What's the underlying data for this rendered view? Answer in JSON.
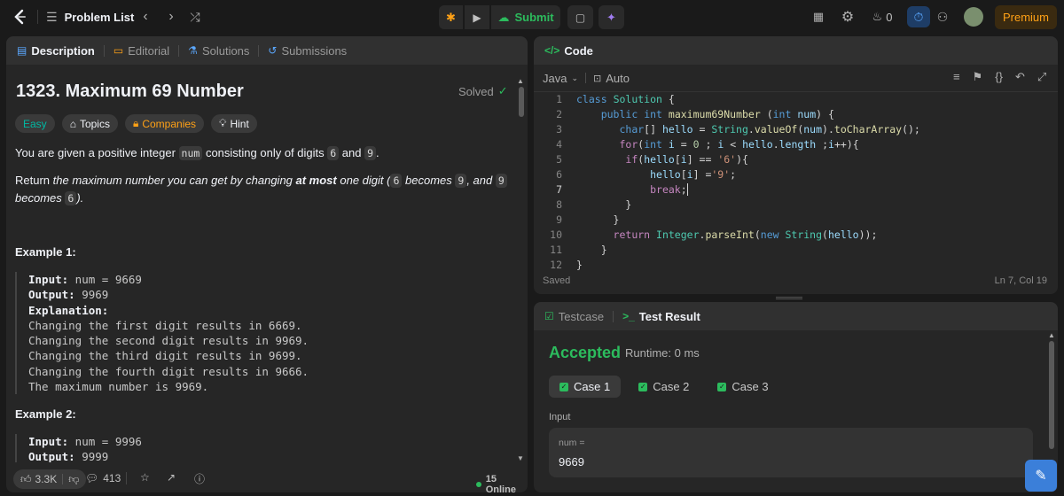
{
  "nav": {
    "problem_list": "Problem List",
    "submit": "Submit",
    "streak": "0",
    "premium": "Premium"
  },
  "left": {
    "tabs": [
      {
        "label": "Description"
      },
      {
        "label": "Editorial"
      },
      {
        "label": "Solutions"
      },
      {
        "label": "Submissions"
      }
    ],
    "title": "1323. Maximum 69 Number",
    "solved": "Solved",
    "tags": [
      "Easy",
      "Topics",
      "Companies",
      "Hint"
    ],
    "desc1_a": "You are given a positive integer ",
    "desc1_code": "num",
    "desc1_b": " consisting only of digits ",
    "d6": "6",
    "and": " and ",
    "d9": "9",
    "dot": ".",
    "desc2_a": "Return ",
    "desc2_it1": "the maximum number you can get by changing ",
    "desc2_bold": "at most",
    "desc2_it2": " one digit (",
    "becomes": " becomes ",
    "comma_and": ", and ",
    "desc2_end": ").",
    "example1_title": "Example 1:",
    "example1": {
      "input_label": "Input:",
      "input_val": " num = 9669",
      "output_label": "Output:",
      "output_val": " 9969",
      "explanation_label": "Explanation:",
      "lines": [
        "Changing the first digit results in 6669.",
        "Changing the second digit results in 9969.",
        "Changing the third digit results in 9699.",
        "Changing the fourth digit results in 9666.",
        "The maximum number is 9969."
      ]
    },
    "example2_title": "Example 2:",
    "example2": {
      "input_label": "Input:",
      "input_val": " num = 9996",
      "output_label": "Output:",
      "output_val": " 9999"
    },
    "likes": "3.3K",
    "comments": "413",
    "online": "15 Online"
  },
  "code": {
    "tab": "Code",
    "language": "Java",
    "auto": "Auto",
    "line_numbers": [
      "1",
      "2",
      "3",
      "4",
      "5",
      "6",
      "7",
      "8",
      "9",
      "10",
      "11",
      "12"
    ],
    "status": "Saved",
    "cursor": "Ln 7, Col 19"
  },
  "result": {
    "tabs": [
      "Testcase",
      "Test Result"
    ],
    "status": "Accepted",
    "runtime": "Runtime: 0 ms",
    "cases": [
      "Case 1",
      "Case 2",
      "Case 3"
    ],
    "input_label": "Input",
    "input_key": "num =",
    "input_value": "9669"
  },
  "colors": {
    "accent": "#ffa116",
    "success": "#2cbb5d",
    "easy": "#00b8a3"
  }
}
